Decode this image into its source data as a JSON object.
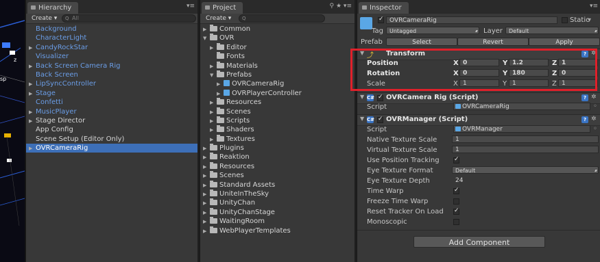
{
  "hierarchy": {
    "tab": "Hierarchy",
    "create": "Create",
    "search_placeholder": "All",
    "items": [
      {
        "label": "Background",
        "color": "blue",
        "arrow": false
      },
      {
        "label": "CharacterLight",
        "color": "blue",
        "arrow": false
      },
      {
        "label": "CandyRockStar",
        "color": "blue",
        "arrow": true
      },
      {
        "label": "Visualizer",
        "color": "blue",
        "arrow": false
      },
      {
        "label": "Back Screen Camera Rig",
        "color": "blue",
        "arrow": true
      },
      {
        "label": "Back Screen",
        "color": "blue",
        "arrow": false
      },
      {
        "label": "LipSyncController",
        "color": "blue",
        "arrow": true
      },
      {
        "label": "Stage",
        "color": "blue",
        "arrow": true
      },
      {
        "label": "Confetti",
        "color": "blue",
        "arrow": false
      },
      {
        "label": "MusicPlayer",
        "color": "blue",
        "arrow": true
      },
      {
        "label": "Stage Director",
        "color": "white",
        "arrow": true
      },
      {
        "label": "App Config",
        "color": "white",
        "arrow": false
      },
      {
        "label": "Scene Setup (Editor Only)",
        "color": "white",
        "arrow": false
      },
      {
        "label": "OVRCameraRig",
        "color": "blue",
        "arrow": true,
        "selected": true
      }
    ]
  },
  "scene": {
    "labels": [
      "z",
      "sp"
    ]
  },
  "project": {
    "tab": "Project",
    "create": "Create",
    "items": [
      {
        "label": "Common",
        "depth": 0,
        "arrow": "right",
        "icon": "folder"
      },
      {
        "label": "OVR",
        "depth": 0,
        "arrow": "down",
        "icon": "folder"
      },
      {
        "label": "Editor",
        "depth": 1,
        "arrow": "right",
        "icon": "folder"
      },
      {
        "label": "Fonts",
        "depth": 1,
        "arrow": "",
        "icon": "folder"
      },
      {
        "label": "Materials",
        "depth": 1,
        "arrow": "right",
        "icon": "folder"
      },
      {
        "label": "Prefabs",
        "depth": 1,
        "arrow": "down",
        "icon": "folder"
      },
      {
        "label": "OVRCameraRig",
        "depth": 2,
        "arrow": "right",
        "icon": "prefab"
      },
      {
        "label": "OVRPlayerController",
        "depth": 2,
        "arrow": "right",
        "icon": "prefab"
      },
      {
        "label": "Resources",
        "depth": 1,
        "arrow": "right",
        "icon": "folder"
      },
      {
        "label": "Scenes",
        "depth": 1,
        "arrow": "right",
        "icon": "folder"
      },
      {
        "label": "Scripts",
        "depth": 1,
        "arrow": "right",
        "icon": "folder"
      },
      {
        "label": "Shaders",
        "depth": 1,
        "arrow": "right",
        "icon": "folder"
      },
      {
        "label": "Textures",
        "depth": 1,
        "arrow": "right",
        "icon": "folder"
      },
      {
        "label": "Plugins",
        "depth": 0,
        "arrow": "right",
        "icon": "folder"
      },
      {
        "label": "Reaktion",
        "depth": 0,
        "arrow": "right",
        "icon": "folder"
      },
      {
        "label": "Resources",
        "depth": 0,
        "arrow": "right",
        "icon": "folder"
      },
      {
        "label": "Scenes",
        "depth": 0,
        "arrow": "right",
        "icon": "folder"
      },
      {
        "label": "Standard Assets",
        "depth": 0,
        "arrow": "right",
        "icon": "folder"
      },
      {
        "label": "UniteInTheSky",
        "depth": 0,
        "arrow": "right",
        "icon": "folder"
      },
      {
        "label": "UnityChan",
        "depth": 0,
        "arrow": "right",
        "icon": "folder"
      },
      {
        "label": "UnityChanStage",
        "depth": 0,
        "arrow": "right",
        "icon": "folder"
      },
      {
        "label": "WaitingRoom",
        "depth": 0,
        "arrow": "right",
        "icon": "folder"
      },
      {
        "label": "WebPlayerTemplates",
        "depth": 0,
        "arrow": "right",
        "icon": "folder"
      }
    ]
  },
  "inspector": {
    "tab": "Inspector",
    "object_name": "OVRCameraRig",
    "static_label": "Static",
    "tag_label": "Tag",
    "tag_value": "Untagged",
    "layer_label": "Layer",
    "layer_value": "Default",
    "prefab_label": "Prefab",
    "prefab_select": "Select",
    "prefab_revert": "Revert",
    "prefab_apply": "Apply",
    "transform": {
      "title": "Transform",
      "rows": [
        {
          "label": "Position",
          "x": "0",
          "y": "1.2",
          "z": "1",
          "bold": true
        },
        {
          "label": "Rotation",
          "x": "0",
          "y": "180",
          "z": "0",
          "bold": true
        },
        {
          "label": "Scale",
          "x": "1",
          "y": "1",
          "z": "1",
          "bold": false
        }
      ],
      "axis": {
        "x": "X",
        "y": "Y",
        "z": "Z"
      }
    },
    "rig_script": {
      "title": "OVRCamera Rig (Script)",
      "script_label": "Script",
      "script_value": "OVRCameraRig"
    },
    "manager": {
      "title": "OVRManager (Script)",
      "script_label": "Script",
      "script_value": "OVRManager",
      "native_scale_label": "Native Texture Scale",
      "native_scale_value": "1",
      "virtual_scale_label": "Virtual Texture Scale",
      "virtual_scale_value": "1",
      "position_tracking_label": "Use Position Tracking",
      "eye_format_label": "Eye Texture Format",
      "eye_format_value": "Default",
      "eye_depth_label": "Eye Texture Depth",
      "eye_depth_value": "24",
      "time_warp_label": "Time Warp",
      "freeze_label": "Freeze Time Warp",
      "reset_label": "Reset Tracker On Load",
      "mono_label": "Monoscopic"
    },
    "add_component": "Add Component"
  }
}
